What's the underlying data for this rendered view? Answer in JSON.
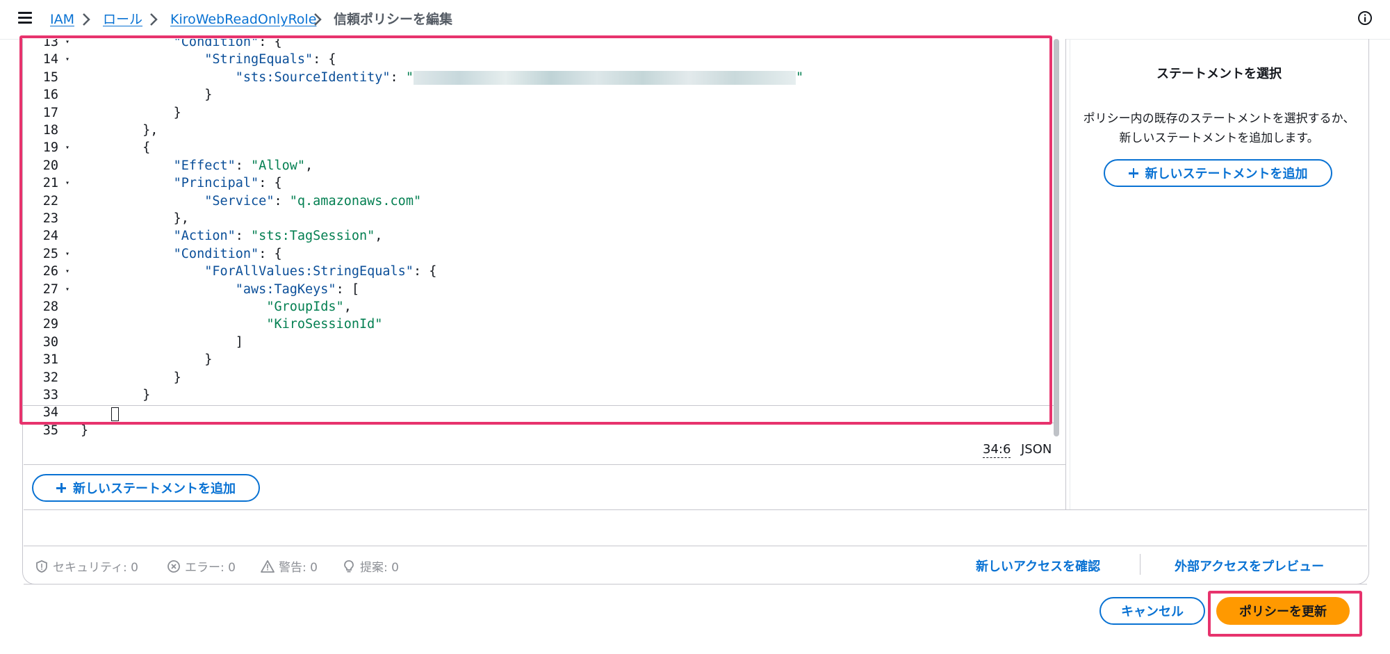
{
  "breadcrumb": {
    "items": [
      "IAM",
      "ロール",
      "KiroWebReadOnlyRole"
    ],
    "current": "信頼ポリシーを編集"
  },
  "editor": {
    "lines": [
      {
        "n": "13",
        "fold": "▾",
        "tokens": [
          {
            "t": "            ",
            "c": "p"
          },
          {
            "t": "\"Condition\"",
            "c": "k"
          },
          {
            "t": ": {",
            "c": "p"
          }
        ]
      },
      {
        "n": "14",
        "fold": "▾",
        "tokens": [
          {
            "t": "                ",
            "c": "p"
          },
          {
            "t": "\"StringEquals\"",
            "c": "k"
          },
          {
            "t": ": {",
            "c": "p"
          }
        ]
      },
      {
        "n": "15",
        "fold": "",
        "tokens": [
          {
            "t": "                    ",
            "c": "p"
          },
          {
            "t": "\"sts:SourceIdentity\"",
            "c": "k"
          },
          {
            "t": ": ",
            "c": "p"
          },
          {
            "t": "\"",
            "c": "s"
          },
          {
            "t": "",
            "c": "blur"
          },
          {
            "t": "\"",
            "c": "s"
          }
        ]
      },
      {
        "n": "16",
        "fold": "",
        "tokens": [
          {
            "t": "                }",
            "c": "p"
          }
        ]
      },
      {
        "n": "17",
        "fold": "",
        "tokens": [
          {
            "t": "            }",
            "c": "p"
          }
        ]
      },
      {
        "n": "18",
        "fold": "",
        "tokens": [
          {
            "t": "        },",
            "c": "p"
          }
        ]
      },
      {
        "n": "19",
        "fold": "▾",
        "tokens": [
          {
            "t": "        {",
            "c": "p"
          }
        ]
      },
      {
        "n": "20",
        "fold": "",
        "tokens": [
          {
            "t": "            ",
            "c": "p"
          },
          {
            "t": "\"Effect\"",
            "c": "k"
          },
          {
            "t": ": ",
            "c": "p"
          },
          {
            "t": "\"Allow\"",
            "c": "s"
          },
          {
            "t": ",",
            "c": "p"
          }
        ]
      },
      {
        "n": "21",
        "fold": "▾",
        "tokens": [
          {
            "t": "            ",
            "c": "p"
          },
          {
            "t": "\"Principal\"",
            "c": "k"
          },
          {
            "t": ": {",
            "c": "p"
          }
        ]
      },
      {
        "n": "22",
        "fold": "",
        "tokens": [
          {
            "t": "                ",
            "c": "p"
          },
          {
            "t": "\"Service\"",
            "c": "k"
          },
          {
            "t": ": ",
            "c": "p"
          },
          {
            "t": "\"q.amazonaws.com\"",
            "c": "s"
          }
        ]
      },
      {
        "n": "23",
        "fold": "",
        "tokens": [
          {
            "t": "            },",
            "c": "p"
          }
        ]
      },
      {
        "n": "24",
        "fold": "",
        "tokens": [
          {
            "t": "            ",
            "c": "p"
          },
          {
            "t": "\"Action\"",
            "c": "k"
          },
          {
            "t": ": ",
            "c": "p"
          },
          {
            "t": "\"sts:TagSession\"",
            "c": "s"
          },
          {
            "t": ",",
            "c": "p"
          }
        ]
      },
      {
        "n": "25",
        "fold": "▾",
        "tokens": [
          {
            "t": "            ",
            "c": "p"
          },
          {
            "t": "\"Condition\"",
            "c": "k"
          },
          {
            "t": ": {",
            "c": "p"
          }
        ]
      },
      {
        "n": "26",
        "fold": "▾",
        "tokens": [
          {
            "t": "                ",
            "c": "p"
          },
          {
            "t": "\"ForAllValues:StringEquals\"",
            "c": "k"
          },
          {
            "t": ": {",
            "c": "p"
          }
        ]
      },
      {
        "n": "27",
        "fold": "▾",
        "tokens": [
          {
            "t": "                    ",
            "c": "p"
          },
          {
            "t": "\"aws:TagKeys\"",
            "c": "k"
          },
          {
            "t": ": [",
            "c": "p"
          }
        ]
      },
      {
        "n": "28",
        "fold": "",
        "tokens": [
          {
            "t": "                        ",
            "c": "p"
          },
          {
            "t": "\"GroupIds\"",
            "c": "s"
          },
          {
            "t": ",",
            "c": "p"
          }
        ]
      },
      {
        "n": "29",
        "fold": "",
        "tokens": [
          {
            "t": "                        ",
            "c": "p"
          },
          {
            "t": "\"KiroSessionId\"",
            "c": "s"
          }
        ]
      },
      {
        "n": "30",
        "fold": "",
        "tokens": [
          {
            "t": "                    ]",
            "c": "p"
          }
        ]
      },
      {
        "n": "31",
        "fold": "",
        "tokens": [
          {
            "t": "                }",
            "c": "p"
          }
        ]
      },
      {
        "n": "32",
        "fold": "",
        "tokens": [
          {
            "t": "            }",
            "c": "p"
          }
        ]
      },
      {
        "n": "33",
        "fold": "",
        "tokens": [
          {
            "t": "        }",
            "c": "p"
          }
        ]
      },
      {
        "n": "34",
        "fold": "",
        "tokens": [
          {
            "t": "",
            "c": "p"
          }
        ]
      },
      {
        "n": "35",
        "fold": "",
        "tokens": [
          {
            "t": "}",
            "c": "p"
          }
        ]
      }
    ],
    "cursor_position": "34:6",
    "mode": "JSON",
    "add_statement_label": "新しいステートメントを追加"
  },
  "side_panel": {
    "title": "ステートメントを選択",
    "description": "ポリシー内の既存のステートメントを選択するか、新しいステートメントを追加します。",
    "add_statement_label": "新しいステートメントを追加"
  },
  "validation": {
    "security": "セキュリティ: 0",
    "errors": "エラー: 0",
    "warnings": "警告: 0",
    "suggestions": "提案: 0",
    "review_access": "新しいアクセスを確認",
    "preview_external": "外部アクセスをプレビュー"
  },
  "footer": {
    "cancel_label": "キャンセル",
    "update_label": "ポリシーを更新"
  },
  "colors": {
    "link": "#0972d3",
    "primary_button": "#ff9900",
    "highlight": "#e7336d",
    "json_key": "#0b4f99",
    "json_string": "#037f51"
  }
}
